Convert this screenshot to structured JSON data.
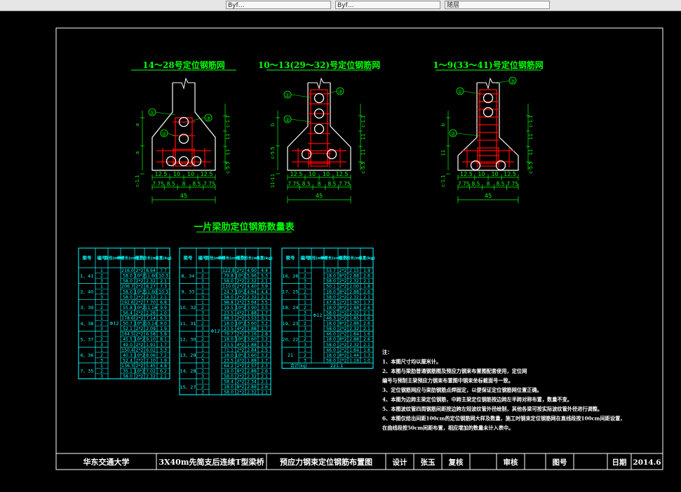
{
  "toolbar": {
    "field1": "Byf…",
    "field2": "Byf…",
    "field3": "随层"
  },
  "colors": {
    "frame": "#ffffff",
    "title": "#00ff00",
    "concrete": "#ffffff",
    "rebar": "#ff0000",
    "duct": "#ffffff",
    "dim": "#00ff00",
    "table": "#00ffff",
    "label": "#ffff00"
  },
  "sections": [
    {
      "title": "14～28号定位钢筋网",
      "dims_bottom": [
        "12.5",
        "10",
        "10",
        "12.5"
      ],
      "dims_sub": [
        "7.75",
        "8.5",
        "8",
        "8.5",
        "7.75"
      ],
      "total": "45",
      "v_labels": [
        "a",
        "a",
        "c-1.1"
      ],
      "callouts": [
        "①",
        "②",
        "③"
      ]
    },
    {
      "title": "10～13(29～32)号定位钢筋网",
      "dims_bottom": [
        "12.5",
        "10",
        "10",
        "12.5"
      ],
      "dims_sub": [
        "7.75",
        "8.5",
        "8",
        "8.5",
        "7.75"
      ],
      "total": "45",
      "v_labels": [
        "b",
        "c-5.5",
        "11-11"
      ],
      "callouts": [
        "①",
        "②",
        "③"
      ]
    },
    {
      "title": "1～9(33～41)号定位钢筋网",
      "dims_bottom": [
        "12.5",
        "10",
        "10",
        "12.5"
      ],
      "dims_sub": [
        "7.75",
        "8.5",
        "8",
        "8.5",
        "7.75"
      ],
      "total": "45",
      "v_labels": [
        "b",
        "11",
        "c-1.1"
      ],
      "callouts": [
        "①",
        "②",
        "③"
      ]
    }
  ],
  "table_title": "一片梁肋定位钢筋数量表",
  "table_headers": [
    "梁号",
    "编号",
    "直径(mm)",
    "单根长(cm)",
    "根数",
    "总长(m)",
    "总重(kg)"
  ],
  "tables": [
    {
      "groups": [
        {
          "beam": "1、41",
          "rows": [
            [
              "1",
              "216.0",
              "2*2",
              "8.64",
              "7.7"
            ],
            [
              "2",
              "58.0",
              "10*2",
              "11.60",
              "10.3"
            ],
            [
              "3",
              "58.0",
              "2*2",
              "2.32",
              "2.1"
            ]
          ]
        },
        {
          "beam": "2、40",
          "rows": [
            [
              "1",
              "206.7",
              "2*2",
              "8.27",
              "7.3"
            ],
            [
              "2",
              "58.0",
              "10*2",
              "11.60",
              "10.3"
            ],
            [
              "3",
              "58.0",
              "2*2",
              "2.32",
              "2.1"
            ]
          ]
        },
        {
          "beam": "3、39",
          "rows": [
            [
              "1",
              "192.6",
              "2*2",
              "7.70",
              "6.8"
            ],
            [
              "2",
              "55.8",
              "10*2",
              "11.16",
              "9.9"
            ],
            [
              "3",
              "56.4",
              "2*2",
              "2.26",
              "2.0"
            ]
          ]
        },
        {
          "beam": "4、38",
          "rows": [
            [
              "1",
              "178.6",
              "2*2",
              "7.14",
              "6.3"
            ],
            [
              "2",
              "50.7",
              "10*2",
              "10.14",
              "9.0"
            ],
            [
              "3",
              "52.1",
              "2*2",
              "2.09",
              "1.9"
            ]
          ]
        },
        {
          "beam": "5、37",
          "rows": [
            [
              "1",
              "164.5",
              "2*2",
              "6.58",
              "5.8"
            ],
            [
              "2",
              "45.5",
              "10*2",
              "9.10",
              "8.1"
            ],
            [
              "3",
              "49.0",
              "2*2",
              "1.91",
              "1.7"
            ]
          ]
        },
        {
          "beam": "6、36",
          "rows": [
            [
              "1",
              "150.4",
              "2*2",
              "6.02",
              "5.3"
            ],
            [
              "2",
              "40.3",
              "10*2",
              "8.06",
              "7.2"
            ],
            [
              "3",
              "52.4",
              "2*2",
              "2.10",
              "1.9"
            ]
          ]
        },
        {
          "beam": "7、35",
          "rows": [
            [
              "1",
              "136.3",
              "2*2",
              "5.45",
              "4.8"
            ],
            [
              "2",
              "35.1",
              "10*2",
              "7.02",
              "6.2"
            ],
            [
              "3",
              "58.0",
              "2*2",
              "2.32",
              "2.1"
            ]
          ]
        }
      ],
      "dia": "Φ12"
    },
    {
      "groups": [
        {
          "beam": "8、34",
          "rows": [
            [
              "1",
              "122.8",
              "2*2",
              "4.90",
              "4.4"
            ],
            [
              "2",
              "79.8",
              "10*2",
              "5.96",
              "5.3"
            ],
            [
              "3",
              "58.0",
              "2*2",
              "2.32",
              "2.1"
            ]
          ]
        },
        {
          "beam": "9、33",
          "rows": [
            [
              "1",
              "110.0",
              "2*2",
              "4.40",
              "3.9"
            ],
            [
              "2",
              "24.7",
              "10*2",
              "4.94",
              "4.4"
            ],
            [
              "3",
              "58.0",
              "2*2",
              "2.32",
              "2.1"
            ]
          ]
        },
        {
          "beam": "10、32",
          "rows": [
            [
              "1",
              "98.8",
              "2*2",
              "3.94",
              "3.5"
            ],
            [
              "2",
              "19.5",
              "10*2",
              "3.90",
              "3.5"
            ],
            [
              "3",
              "23.5",
              "4*2",
              "1.88",
              "1.7"
            ]
          ]
        },
        {
          "beam": "11、31",
          "rows": [
            [
              "1",
              "88.3",
              "2*2",
              "3.53",
              "3.1"
            ],
            [
              "2",
              "18.0",
              "10*2",
              "3.60",
              "3.2"
            ],
            [
              "3",
              "23.5",
              "4*2",
              "1.88",
              "1.7"
            ]
          ]
        },
        {
          "beam": "12、30",
          "rows": [
            [
              "1",
              "79.7",
              "2*2",
              "3.16",
              "2.8"
            ],
            [
              "2",
              "18.0",
              "10*2",
              "3.60",
              "3.2"
            ],
            [
              "3",
              "23.5",
              "4*2",
              "1.88",
              "1.7"
            ]
          ]
        },
        {
          "beam": "13、29",
          "rows": [
            [
              "1",
              "71.1",
              "2*2",
              "2.84",
              "2.5"
            ],
            [
              "2",
              "18.0",
              "10*2",
              "3.60",
              "3.2"
            ],
            [
              "3",
              "23.5",
              "4*2",
              "1.88",
              "1.7"
            ]
          ]
        },
        {
          "beam": "14、28",
          "rows": [
            [
              "1",
              "64.2",
              "2*2",
              "2.57",
              "2.3"
            ],
            [
              "2",
              "18.0",
              "8*2",
              "2.88",
              "2.6"
            ],
            [
              "3",
              "58.0",
              "2*2",
              "2.32",
              "2.1"
            ]
          ]
        },
        {
          "beam": "15、27",
          "rows": [
            [
              "1",
              "58.4",
              "2*2",
              "2.34",
              "2.1"
            ],
            [
              "2",
              "18.0",
              "8*2",
              "2.88",
              "2.6"
            ],
            [
              "3",
              "58.0",
              "2*2",
              "2.32",
              "2.1"
            ]
          ]
        }
      ],
      "dia": "Φ12"
    },
    {
      "groups": [
        {
          "beam": "16、26",
          "rows": [
            [
              "1",
              "53.7",
              "2*2",
              "2.15",
              "1.9"
            ],
            [
              "2",
              "18.0",
              "8*2",
              "2.88",
              "2.6"
            ],
            [
              "3",
              "58.0",
              "2*2",
              "2.32",
              "2.1"
            ]
          ]
        },
        {
          "beam": "17、25",
          "rows": [
            [
              "1",
              "50.1",
              "2*2",
              "2.00",
              "1.8"
            ],
            [
              "2",
              "18.0",
              "8*2",
              "2.88",
              "2.6"
            ],
            [
              "3",
              "58.0",
              "2*2",
              "2.32",
              "2.1"
            ]
          ]
        },
        {
          "beam": "18、24",
          "rows": [
            [
              "1",
              "47.8",
              "2*2",
              "1.90",
              "1.7"
            ],
            [
              "2",
              "18.0",
              "8*2",
              "2.88",
              "2.6"
            ],
            [
              "3",
              "58.0",
              "2*2",
              "2.32",
              "2.1"
            ]
          ]
        },
        {
          "beam": "19、23",
          "rows": [
            [
              "1",
              "46.3",
              "2*2",
              "1.85",
              "1.6"
            ],
            [
              "2",
              "18.0",
              "8*2",
              "2.88",
              "2.6"
            ],
            [
              "3",
              "58.0",
              "2*2",
              "2.32",
              "2.1"
            ]
          ]
        },
        {
          "beam": "20、22",
          "rows": [
            [
              "1",
              "46.0",
              "2*2",
              "1.84",
              "1.6"
            ],
            [
              "2",
              "18.0",
              "8*2",
              "2.88",
              "2.6"
            ],
            [
              "3",
              "58.0",
              "2*2",
              "2.32",
              "2.1"
            ]
          ]
        },
        {
          "beam": "21",
          "rows": [
            [
              "1",
              "46.0",
              "2*2",
              "1.84",
              "1.6"
            ],
            [
              "2",
              "18.0",
              "8*2",
              "1.44",
              "1.3"
            ],
            [
              "3",
              "58.0",
              "2*2",
              "1.18",
              "1.0"
            ]
          ]
        }
      ],
      "dia": "Φ12",
      "total_label": "合计(kg)",
      "total_value": "221.1"
    }
  ],
  "notes": [
    "注：",
    "1、本图尺寸均以厘米计。",
    "2、本图与梁肋普通钢筋图及预应力钢束布置图配套使用，定位网",
    "    编号与预制主梁预应力钢束布置图中钢束坐标截面号一致。",
    "3、定位钢筋网应与梁肋钢筋点焊固定，以便保证定位钢筋网位置正确。",
    "4、本图为边跨主梁定位钢筋，中跨主梁定位钢筋按边跨左半跨对称布置，数量不变。",
    "5、本图波纹管四周钢筋间距按边跨左短波纹管外径绘制，其他各梁可按实际波纹管外径进行调整。",
    "6、本图仅给出间距100cm的定位钢筋网大样及数量，施工时钢束定位钢筋网在直线段按100cm间距设置，",
    "    在曲线段按50cm间距布置，相应增加的数量未计入表中。"
  ],
  "titleblock": {
    "school": "华东交通大学",
    "project": "3X40m先简支后连续T型梁桥",
    "drawing": "预应力钢束定位钢筋布置图",
    "design_label": "设计",
    "designer": "张玉",
    "check_label": "复核",
    "review_label": "审核",
    "sheet_label": "图号",
    "date_label": "日期",
    "date": "2014.6"
  }
}
